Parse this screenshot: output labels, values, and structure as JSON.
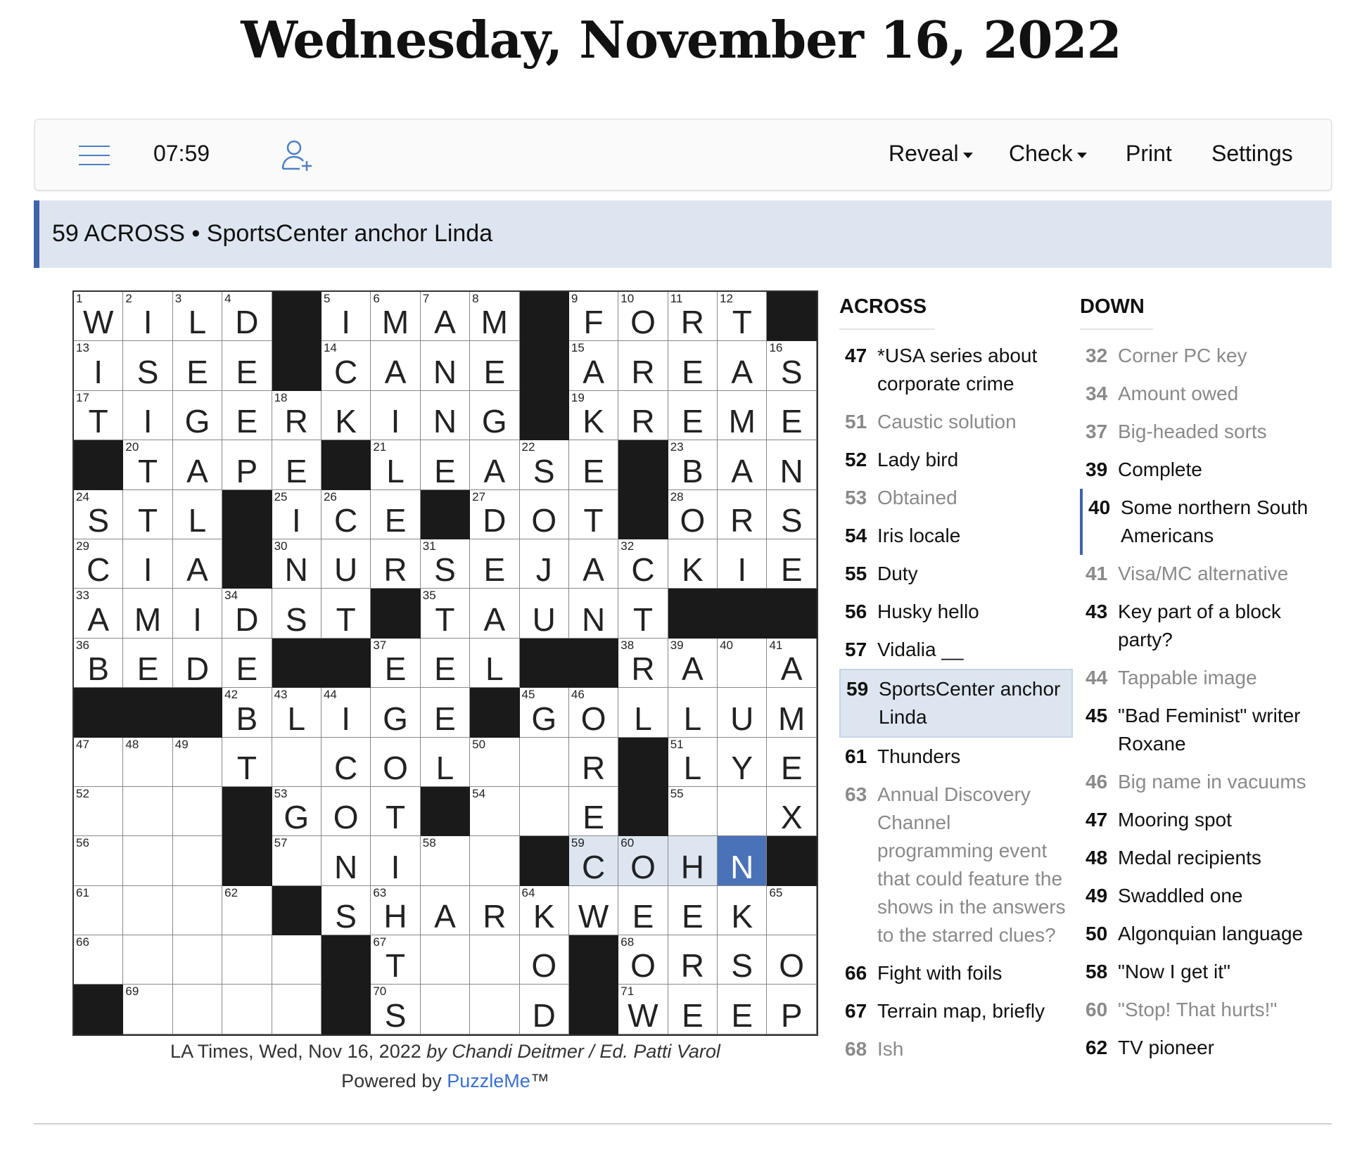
{
  "page_title": "Wednesday, November 16, 2022",
  "toolbar": {
    "timer": "07:59",
    "reveal_label": "Reveal",
    "check_label": "Check",
    "print_label": "Print",
    "settings_label": "Settings"
  },
  "current_clue": {
    "text": "59 ACROSS • SportsCenter anchor Linda"
  },
  "grid": {
    "rows": [
      "WILD#IMAM#FORT#",
      "ISEE#CANE#AREAS",
      "TIGERKING#KREME",
      "#TAPE#LEASE#BAN",
      "STL#ICE#DOT#ORS",
      "CIA#NURSEJACKIE",
      "AMIDST#TAUNT###",
      "BEDE##EEL##RA.A",
      "###BLIGE#GOLLUM",
      "...T.COL..R#LYE",
      "...#GOT#..E#..X",
      "...#.NI..#COHN#",
      "....#SHARKWEEK",
      ".....#T..O#ORSO",
      "#....#S..D#WEEP"
    ],
    "numbers": [
      [
        1,
        2,
        3,
        4,
        0,
        5,
        6,
        7,
        8,
        0,
        9,
        10,
        11,
        12,
        0
      ],
      [
        13,
        0,
        0,
        0,
        0,
        14,
        0,
        0,
        0,
        0,
        15,
        0,
        0,
        0,
        16
      ],
      [
        17,
        0,
        0,
        0,
        18,
        0,
        0,
        0,
        0,
        0,
        19,
        0,
        0,
        0,
        0
      ],
      [
        0,
        20,
        0,
        0,
        0,
        0,
        21,
        0,
        0,
        22,
        0,
        0,
        23,
        0,
        0
      ],
      [
        24,
        0,
        0,
        0,
        25,
        26,
        0,
        0,
        27,
        0,
        0,
        0,
        28,
        0,
        0
      ],
      [
        29,
        0,
        0,
        0,
        30,
        0,
        0,
        31,
        0,
        0,
        0,
        32,
        0,
        0,
        0
      ],
      [
        33,
        0,
        0,
        34,
        0,
        0,
        0,
        35,
        0,
        0,
        0,
        0,
        0,
        0,
        0
      ],
      [
        36,
        0,
        0,
        0,
        0,
        0,
        37,
        0,
        0,
        0,
        0,
        38,
        39,
        40,
        41
      ],
      [
        0,
        0,
        0,
        42,
        43,
        44,
        0,
        0,
        0,
        45,
        46,
        0,
        0,
        0,
        0
      ],
      [
        47,
        48,
        49,
        0,
        0,
        0,
        0,
        0,
        50,
        0,
        0,
        0,
        51,
        0,
        0
      ],
      [
        52,
        0,
        0,
        0,
        53,
        0,
        0,
        0,
        54,
        0,
        0,
        0,
        55,
        0,
        0
      ],
      [
        56,
        0,
        0,
        0,
        57,
        0,
        0,
        58,
        0,
        0,
        59,
        60,
        0,
        0,
        0
      ],
      [
        61,
        0,
        0,
        62,
        0,
        0,
        63,
        0,
        0,
        64,
        0,
        0,
        0,
        0,
        65
      ],
      [
        66,
        0,
        0,
        0,
        0,
        0,
        67,
        0,
        0,
        0,
        0,
        68,
        0,
        0,
        0
      ],
      [
        0,
        69,
        0,
        0,
        0,
        0,
        70,
        0,
        0,
        0,
        0,
        71,
        0,
        0,
        0
      ]
    ],
    "highlight": {
      "row": 11,
      "cols": [
        10,
        11,
        12,
        13
      ],
      "cursor_col": 13
    }
  },
  "attribution": {
    "text": "LA Times, Wed, Nov 16, 2022 ",
    "byline": "by Chandi Deitmer / Ed. Patti Varol",
    "powered_prefix": "Powered by ",
    "powered_brand": "PuzzleMe",
    "powered_suffix": "™"
  },
  "across": {
    "heading": "ACROSS",
    "clues": [
      {
        "num": "47",
        "text": "*USA series about corporate crime",
        "state": "normal"
      },
      {
        "num": "51",
        "text": "Caustic solution",
        "state": "dim"
      },
      {
        "num": "52",
        "text": "Lady bird",
        "state": "normal"
      },
      {
        "num": "53",
        "text": "Obtained",
        "state": "dim"
      },
      {
        "num": "54",
        "text": "Iris locale",
        "state": "normal"
      },
      {
        "num": "55",
        "text": "Duty",
        "state": "normal"
      },
      {
        "num": "56",
        "text": "Husky hello",
        "state": "normal"
      },
      {
        "num": "57",
        "text": "Vidalia __",
        "state": "normal"
      },
      {
        "num": "59",
        "text": "SportsCenter anchor Linda",
        "state": "active"
      },
      {
        "num": "61",
        "text": "Thunders",
        "state": "normal"
      },
      {
        "num": "63",
        "text": "Annual Discovery Channel programming event that could feature the shows in the answers to the starred clues?",
        "state": "dim"
      },
      {
        "num": "66",
        "text": "Fight with foils",
        "state": "normal"
      },
      {
        "num": "67",
        "text": "Terrain map, briefly",
        "state": "normal"
      },
      {
        "num": "68",
        "text": "Ish",
        "state": "dim"
      }
    ]
  },
  "down": {
    "heading": "DOWN",
    "clues": [
      {
        "num": "32",
        "text": "Corner PC key",
        "state": "dim"
      },
      {
        "num": "34",
        "text": "Amount owed",
        "state": "dim"
      },
      {
        "num": "37",
        "text": "Big-headed sorts",
        "state": "dim"
      },
      {
        "num": "39",
        "text": "Complete",
        "state": "normal"
      },
      {
        "num": "40",
        "text": "Some northern South Americans",
        "state": "cross"
      },
      {
        "num": "41",
        "text": "Visa/MC alternative",
        "state": "dim"
      },
      {
        "num": "43",
        "text": "Key part of a block party?",
        "state": "normal"
      },
      {
        "num": "44",
        "text": "Tappable image",
        "state": "dim"
      },
      {
        "num": "45",
        "text": "\"Bad Feminist\" writer Roxane",
        "state": "normal"
      },
      {
        "num": "46",
        "text": "Big name in vacuums",
        "state": "dim"
      },
      {
        "num": "47",
        "text": "Mooring spot",
        "state": "normal"
      },
      {
        "num": "48",
        "text": "Medal recipients",
        "state": "normal"
      },
      {
        "num": "49",
        "text": "Swaddled one",
        "state": "normal"
      },
      {
        "num": "50",
        "text": "Algonquian language",
        "state": "normal"
      },
      {
        "num": "58",
        "text": "\"Now I get it\"",
        "state": "normal"
      },
      {
        "num": "60",
        "text": "\"Stop! That hurts!\"",
        "state": "dim"
      },
      {
        "num": "62",
        "text": "TV pioneer",
        "state": "normal"
      }
    ]
  },
  "colors": {
    "highlight": "#dde6f0",
    "cursor": "#4a72b8",
    "accent": "#3e64a8",
    "brand_link": "#3a6fd0",
    "dim_text": "#8a8a8a"
  },
  "icons": {
    "menu": "hamburger-menu-icon",
    "add_user": "add-user-icon",
    "dropdown": "caret-down-icon"
  }
}
